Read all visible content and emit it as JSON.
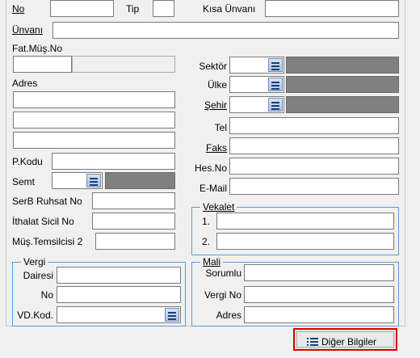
{
  "form": {
    "no_label": "No",
    "tip_label": "Tip",
    "kisa_unvan_label": "Kısa Ünvanı",
    "unvan_label": "Ünvanı",
    "fat_mus_no_label": "Fat.Müş.No",
    "adres_label": "Adres",
    "p_kodu_label": "P.Kodu",
    "semt_label": "Semt",
    "serb_ruhsat_label": "SerB Ruhsat No",
    "ithalat_sicil_label": "İthalat Sicil No",
    "mus_temsilcisi_label": "Müş.Temsilcisi 2",
    "sektor_label": "Sektör",
    "ulke_label": "Ülke",
    "sehir_label": "Şehir",
    "tel_label": "Tel",
    "faks_label": "Faks",
    "hes_no_label": "Hes.No",
    "email_label": "E-Mail"
  },
  "vekalet": {
    "title": "Vekalet",
    "row1_label": "1.",
    "row2_label": "2."
  },
  "vergi": {
    "title": "Vergi",
    "dairesi_label": "Dairesi",
    "no_label": "No",
    "vd_kod_label": "VD.Kod."
  },
  "mali": {
    "title": "Mali",
    "sorumlu_label": "Sorumlu",
    "vergi_no_label": "Vergi No",
    "adres_label": "Adres"
  },
  "other_info_button": {
    "label": "Diğer Bilgiler",
    "icon": "list-icon"
  },
  "colors": {
    "group_border": "#5b9bd5",
    "highlight_border": "#e00000",
    "readonly_fill": "#808080"
  }
}
